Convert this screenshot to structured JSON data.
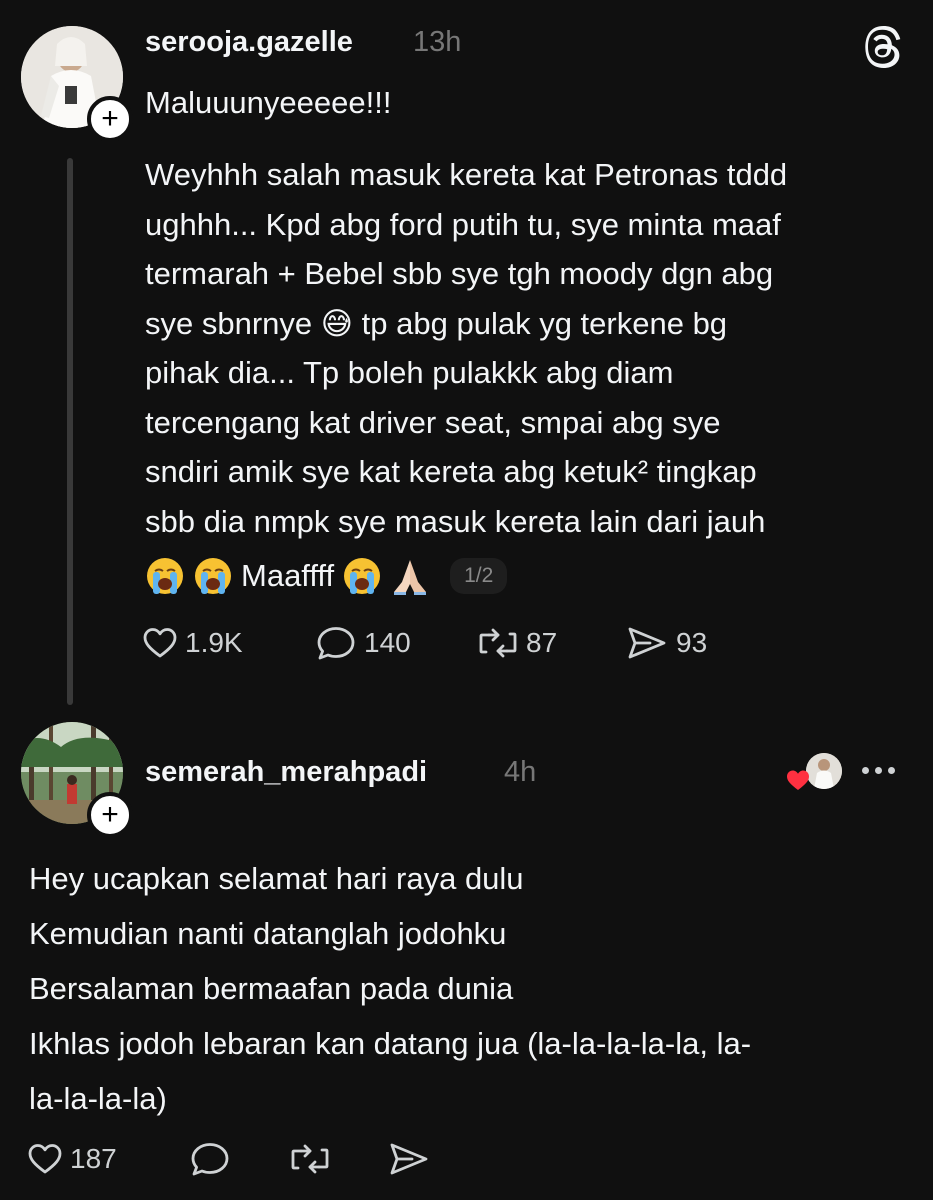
{
  "post1": {
    "username": "serooja.gazelle",
    "time": "13h",
    "headline": "Maluuunyeeeee!!!",
    "body": "Weyhhh salah masuk kereta kat Petronas tddd\nughhh... Kpd abg ford putih tu, sye minta maaf\ntermarah + Bebel sbb sye tgh moody dgn abg\nsye sbnrnye 😅 tp abg pulak yg terkene bg\npihak dia... Tp boleh pulakkk abg diam\ntercengang kat driver seat, smpai abg sye\nsndiri amik sye kat kereta abg ketuk² tingkap\nsbb dia nmpk sye masuk kereta lain dari jauh",
    "last_line_text": "Maaffff",
    "page_indicator": "1/2",
    "likes": "1.9K",
    "replies": "140",
    "reposts": "87",
    "shares": "93"
  },
  "post2": {
    "username": "semerah_merahpadi",
    "time": "4h",
    "text": "Hey ucapkan selamat hari raya dulu\nKemudian nanti datanglah jodohku\nBersalaman bermaafan pada dunia\nIkhlas jodoh lebaran kan datang jua (la-la-la-la-la, la-\nla-la-la-la)",
    "likes": "187"
  },
  "icons": {
    "brand": "threads-logo-icon",
    "like": "heart-icon",
    "reply": "comment-icon",
    "repost": "repost-icon",
    "share": "send-icon",
    "follow": "plus-icon",
    "more": "more-icon"
  },
  "colors": {
    "background": "#101010",
    "text": "#f3f5f7",
    "muted": "#777777",
    "reaction_heart": "#ff3040"
  }
}
